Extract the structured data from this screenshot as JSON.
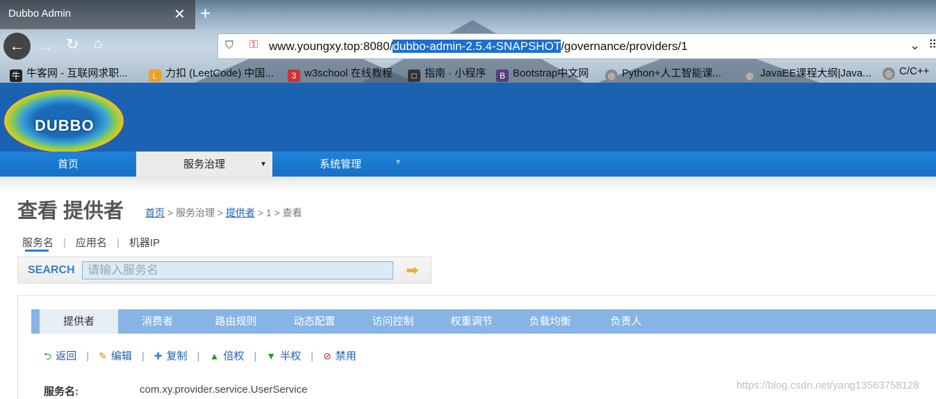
{
  "browser": {
    "tab_title": "Dubbo Admin",
    "tab_close": "✕",
    "new_tab": "+",
    "url_host": "www.youngxy.top:8080/",
    "url_selected": "dubbo-admin-2.5.4-SNAPSHOT",
    "url_rest": "/governance/providers/1",
    "bookmarks": [
      {
        "label": "牛客网 - 互联网求职...",
        "icon": "nowcoder-icon",
        "color": "#222"
      },
      {
        "label": "力扣 (LeetCode) 中国...",
        "icon": "leetcode-icon",
        "color": "#f0a020"
      },
      {
        "label": "w3school 在线教程",
        "icon": "w3school-icon",
        "color": "#c33"
      },
      {
        "label": "指南 · 小程序",
        "icon": "book-icon",
        "color": "#333"
      },
      {
        "label": "Bootstrap中文网",
        "icon": "bootstrap-icon",
        "color": "#563d7c"
      },
      {
        "label": "Python+人工智能课...",
        "icon": "globe-icon",
        "color": "#666"
      },
      {
        "label": "JavaEE课程大纲|Java...",
        "icon": "globe-icon",
        "color": "#666"
      },
      {
        "label": "C/C++",
        "icon": "globe-icon",
        "color": "#666"
      }
    ]
  },
  "header": {
    "logo_text": "DUBBO"
  },
  "menu": {
    "items": [
      {
        "label": "首页"
      },
      {
        "label": "服务治理",
        "arrow": "▼"
      },
      {
        "label": "系统管理",
        "arrow": "▼"
      }
    ]
  },
  "page": {
    "title": "查看 提供者",
    "breadcrumb": {
      "home": "首页",
      "sep1": " > ",
      "section": "服务治理",
      "sep2": " > ",
      "providers": "提供者",
      "tail": " > 1 > 查看"
    },
    "filter_tabs": [
      "服务名",
      "应用名",
      "机器IP"
    ],
    "filter_sep": "|",
    "search": {
      "label": "SEARCH",
      "placeholder": "请输入服务名"
    },
    "subtabs": [
      "提供者",
      "消费者",
      "路由规则",
      "动态配置",
      "访问控制",
      "权重调节",
      "负载均衡",
      "负责人"
    ],
    "actions": [
      {
        "label": "返回",
        "icon": "back-icon",
        "glyph": "⮌",
        "color": "#2a9a2a"
      },
      {
        "label": "编辑",
        "icon": "pencil-icon",
        "glyph": "✎",
        "color": "#d08a10"
      },
      {
        "label": "复制",
        "icon": "copy-icon",
        "glyph": "✚",
        "color": "#3a7fd0"
      },
      {
        "label": "倍权",
        "icon": "arrow-up-icon",
        "glyph": "▲",
        "color": "#2a9a2a"
      },
      {
        "label": "半权",
        "icon": "arrow-down-icon",
        "glyph": "▼",
        "color": "#2a9a2a"
      },
      {
        "label": "禁用",
        "icon": "forbid-icon",
        "glyph": "⊘",
        "color": "#d02020"
      }
    ],
    "action_sep": "|",
    "fields": [
      {
        "label": "服务名:",
        "value": "com.xy.provider.service.UserService"
      }
    ]
  },
  "watermark": "https://blog.csdn.net/yang13563758128"
}
